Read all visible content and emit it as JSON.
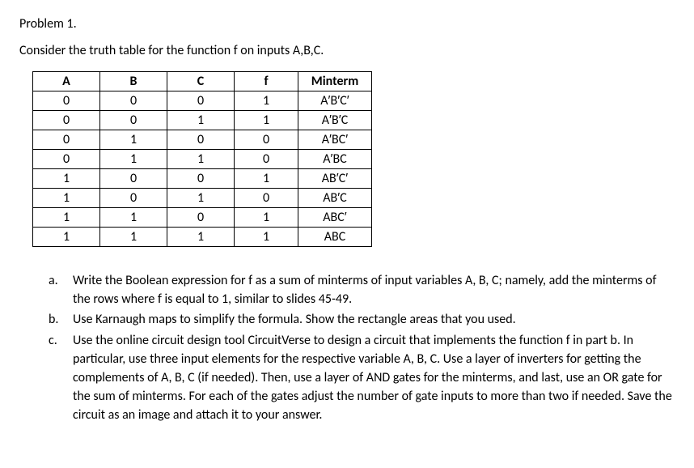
{
  "title": "Problem 1.",
  "intro": "Consider the truth table for the function f on inputs A,B,C.",
  "table": {
    "headers": [
      "A",
      "B",
      "C",
      "f",
      "Minterm"
    ],
    "rows": [
      [
        "0",
        "0",
        "0",
        "1",
        "A′B′C′"
      ],
      [
        "0",
        "0",
        "1",
        "1",
        "A′B′C"
      ],
      [
        "0",
        "1",
        "0",
        "0",
        "A′BC′"
      ],
      [
        "0",
        "1",
        "1",
        "0",
        "A′BC"
      ],
      [
        "1",
        "0",
        "0",
        "1",
        "AB′C′"
      ],
      [
        "1",
        "0",
        "1",
        "0",
        "AB′C"
      ],
      [
        "1",
        "1",
        "0",
        "1",
        "ABC′"
      ],
      [
        "1",
        "1",
        "1",
        "1",
        "ABC"
      ]
    ]
  },
  "questions": [
    {
      "letter": "a.",
      "text": "Write the Boolean expression for f as a sum of minterms of input variables A, B, C; namely, add the minterms of the rows where f is equal to 1, similar to slides 45-49."
    },
    {
      "letter": "b.",
      "text": "Use Karnaugh maps to simplify the formula. Show the rectangle areas that you used."
    },
    {
      "letter": "c.",
      "text": "Use the online circuit design tool CircuitVerse to design a circuit that implements the function f in part b. In particular, use three input elements for the respective variable A, B, C. Use a layer of inverters for getting the complements of A, B, C (if needed). Then, use a layer of AND gates for the minterms, and last, use an OR gate for the sum of minterms. For each of the gates adjust the number of gate inputs to more than two if needed. Save the circuit as an image and attach it to your answer."
    }
  ]
}
